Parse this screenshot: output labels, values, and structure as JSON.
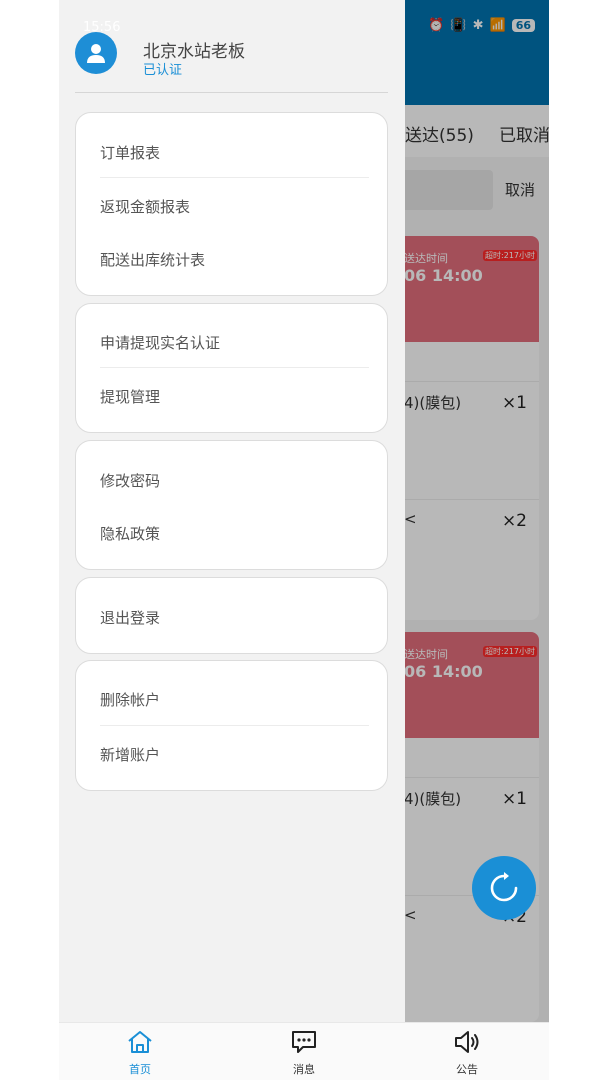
{
  "status_bar": {
    "time": "15:56",
    "battery": "66"
  },
  "background": {
    "tabs": [
      "送达(55)",
      "已取消"
    ],
    "search_cancel": "取消",
    "cards": [
      {
        "time_label": "送达时间",
        "time_value": "06 14:00",
        "overdue": "超时:217小时",
        "items": [
          {
            "name": "4)(膜包)",
            "qty": "×1"
          },
          {
            "name": "<",
            "qty": "×2"
          }
        ]
      },
      {
        "time_label": "送达时间",
        "time_value": "06 14:00",
        "overdue": "超时:217小时",
        "items": [
          {
            "name": "4)(膜包)",
            "qty": "×1"
          },
          {
            "name": "<",
            "qty": "×2"
          }
        ]
      }
    ]
  },
  "drawer": {
    "profile": {
      "name": "北京水站老板",
      "status": "已认证"
    },
    "groups": [
      {
        "items": [
          "订单报表",
          "返现金额报表",
          "配送出库统计表"
        ]
      },
      {
        "items": [
          "申请提现实名认证",
          "提现管理"
        ]
      },
      {
        "items": [
          "修改密码",
          "隐私政策"
        ]
      },
      {
        "items": [
          "退出登录"
        ]
      },
      {
        "items": [
          "删除帐户",
          "新增账户"
        ]
      }
    ]
  },
  "bottom_nav": [
    {
      "label": "首页",
      "icon": "home-icon",
      "active": true
    },
    {
      "label": "消息",
      "icon": "message-icon",
      "active": false
    },
    {
      "label": "公告",
      "icon": "speaker-icon",
      "active": false
    }
  ],
  "colors": {
    "accent": "#1a8fd6",
    "header": "#0073b0",
    "overdue_card": "#e26e7c"
  }
}
